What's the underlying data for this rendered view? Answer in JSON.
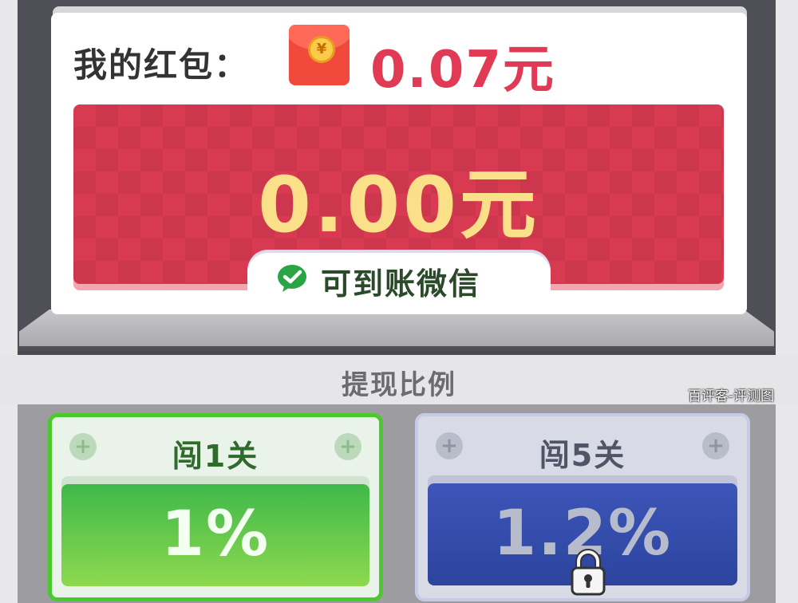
{
  "wallet": {
    "label": "我的红包：",
    "balance": "0.07元",
    "icon": "red-envelope-icon"
  },
  "withdraw": {
    "amount": "0.00元",
    "wechat_text": "可到账微信",
    "wechat_icon": "wechat-check-icon"
  },
  "ratio": {
    "title": "提现比例",
    "levels": [
      {
        "label": "闯1关",
        "percent": "1%",
        "state": "active"
      },
      {
        "label": "闯5关",
        "percent": "1.2%",
        "state": "locked"
      }
    ]
  },
  "watermark": "百评客-评测图",
  "colors": {
    "balance_red": "#e03a54",
    "panel_red": "#d83a52",
    "amount_yellow": "#fbe08a",
    "active_green": "#4cc82f",
    "locked_blue": "#3d56b8"
  }
}
